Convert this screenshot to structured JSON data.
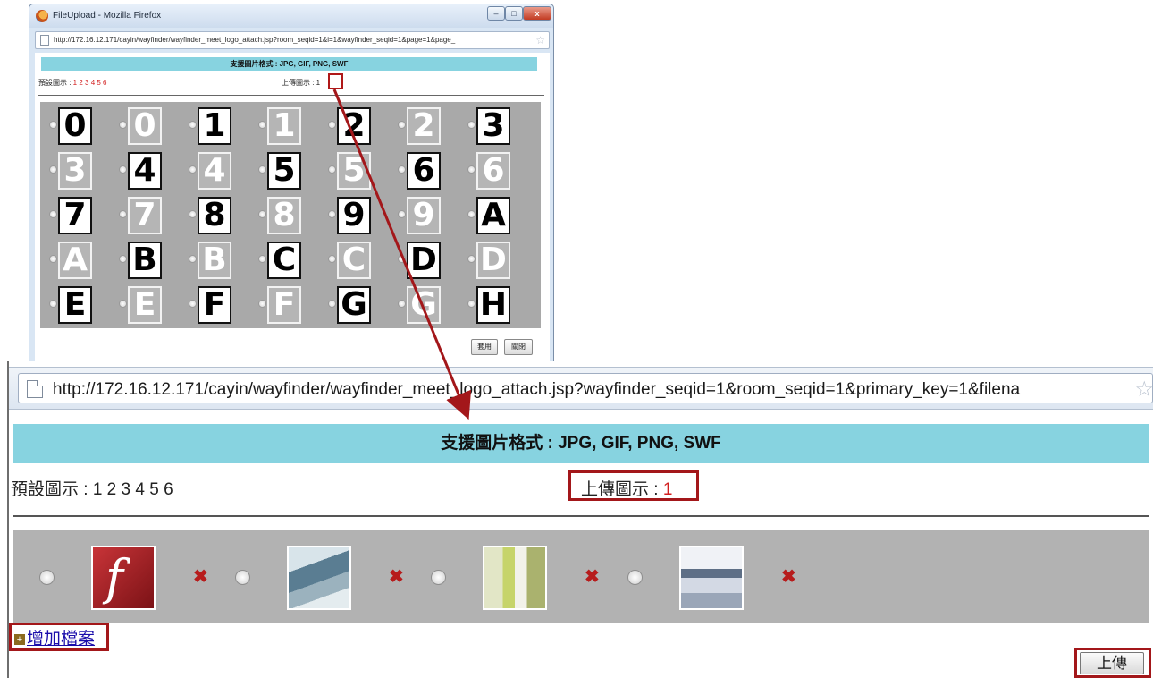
{
  "small_window": {
    "title": "FileUpload - Mozilla Firefox",
    "controls": {
      "minimize": "–",
      "maximize": "□",
      "close": "x"
    },
    "url": "http://172.16.12.171/cayin/wayfinder/wayfinder_meet_logo_attach.jsp?room_seqid=1&i=1&wayfinder_seqid=1&page=1&page_",
    "formats": "支援圖片格式 : JPG, GIF, PNG, SWF",
    "preset_label": "預設圖示 : ",
    "preset_numbers": "1 2 3 4 5 6",
    "upload_label": "上傳圖示 : ",
    "upload_value": "1",
    "tiles": [
      [
        "0",
        "0",
        "1",
        "1",
        "2",
        "2",
        "3"
      ],
      [
        "3",
        "4",
        "4",
        "5",
        "5",
        "6",
        "6"
      ],
      [
        "7",
        "7",
        "8",
        "8",
        "9",
        "9",
        "A"
      ],
      [
        "A",
        "B",
        "B",
        "C",
        "C",
        "D",
        "D"
      ],
      [
        "E",
        "E",
        "F",
        "F",
        "G",
        "G",
        "H"
      ]
    ],
    "apply_button": "套用",
    "close_button": "關閉"
  },
  "zoom_view": {
    "url": "http://172.16.12.171/cayin/wayfinder/wayfinder_meet_logo_attach.jsp?wayfinder_seqid=1&room_seqid=1&primary_key=1&filena",
    "formats": "支援圖片格式 : JPG, GIF, PNG, SWF",
    "preset_label": "預設圖示 : 1 2 3 4 5 6",
    "upload_label": "上傳圖示 : ",
    "upload_value": "1",
    "gallery_items": [
      "flash-logo",
      "photo-1",
      "photo-2",
      "photo-3"
    ],
    "delete_glyph": "✖",
    "add_file": "增加檔案",
    "upload_button": "上傳"
  },
  "colors": {
    "accent_bar": "#87d3e0",
    "highlight_box": "#a3171a",
    "link": "#1a0dab"
  }
}
